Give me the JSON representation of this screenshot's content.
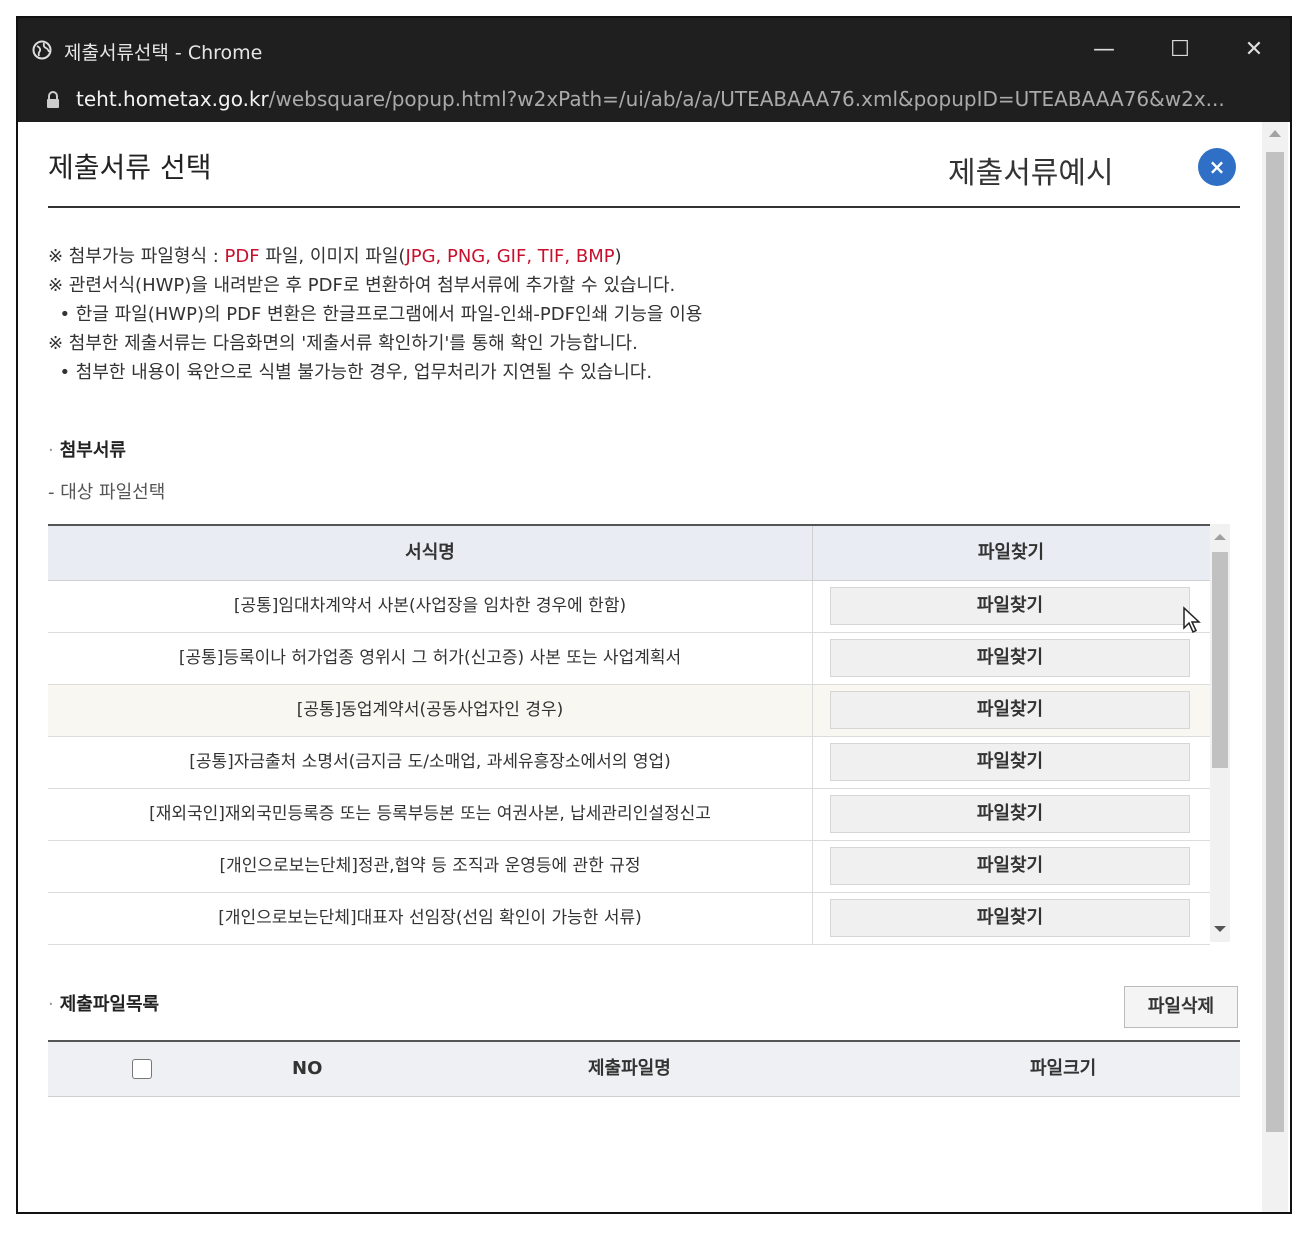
{
  "window": {
    "title": "제출서류선택 - Chrome",
    "url_domain": "teht.hometax.go.kr",
    "url_path": "/websquare/popup.html?w2xPath=/ui/ab/a/a/UTEABAAA76.xml&popupID=UTEABAAA76&w2x...",
    "minimize": "—",
    "maximize": "☐",
    "close": "✕"
  },
  "header": {
    "title": "제출서류 선택",
    "example_link": "제출서류예시",
    "close_icon": "×"
  },
  "notes": {
    "line1_prefix": "※ 첨부가능 파일형식 : ",
    "line1_pdf": "PDF",
    "line1_mid": " 파일, 이미지 파일(",
    "line1_formats": "JPG, PNG, GIF, TIF, BMP",
    "line1_suffix": ")",
    "line2": "※ 관련서식(HWP)을 내려받은 후 PDF로 변환하여 첨부서류에 추가할 수 있습니다.",
    "line3": "  • 한글 파일(HWP)의 PDF 변환은 한글프로그램에서 파일-인쇄-PDF인쇄 기능을 이용",
    "line4": "※ 첨부한 제출서류는 다음화면의 '제출서류 확인하기'를 통해 확인 가능합니다.",
    "line5": "  • 첨부한 내용이 육안으로 식별 불가능한 경우, 업무처리가 지연될 수 있습니다."
  },
  "attachments": {
    "section_label": "첨부서류",
    "sub_label": "- 대상 파일선택",
    "columns": [
      "서식명",
      "파일찾기"
    ],
    "rows": [
      {
        "name": "[공통]임대차계약서 사본(사업장을 임차한 경우에 한함)",
        "button": "파일찾기"
      },
      {
        "name": "[공통]등록이나 허가업종 영위시 그 허가(신고증) 사본 또는 사업계획서",
        "button": "파일찾기"
      },
      {
        "name": "[공통]동업계약서(공동사업자인 경우)",
        "button": "파일찾기"
      },
      {
        "name": "[공통]자금출처 소명서(금지금 도/소매업, 과세유흥장소에서의 영업)",
        "button": "파일찾기"
      },
      {
        "name": "[재외국인]재외국민등록증 또는 등록부등본 또는 여권사본, 납세관리인설정신고",
        "button": "파일찾기"
      },
      {
        "name": "[개인으로보는단체]정관,협약 등 조직과 운영등에 관한 규정",
        "button": "파일찾기"
      },
      {
        "name": "[개인으로보는단체]대표자 선임장(선임 확인이 가능한 서류)",
        "button": "파일찾기"
      }
    ]
  },
  "submitted": {
    "section_label": "제출파일목록",
    "delete_button": "파일삭제",
    "columns": [
      "NO",
      "제출파일명",
      "파일크기"
    ]
  }
}
